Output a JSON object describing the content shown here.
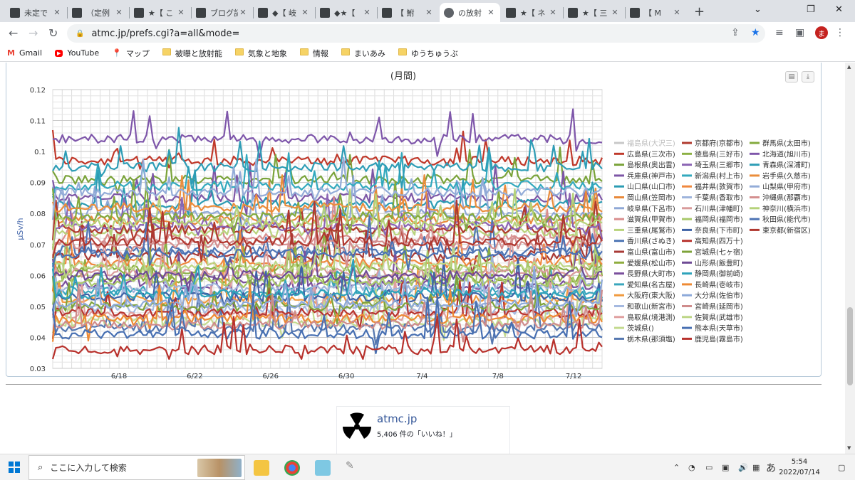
{
  "tabs": [
    {
      "title": "未定で",
      "close": "✕"
    },
    {
      "title": "（定例",
      "close": "✕"
    },
    {
      "title": "★【 こ",
      "close": "✕"
    },
    {
      "title": "ブログ記",
      "close": "✕"
    },
    {
      "title": "◆【 岐",
      "close": "✕"
    },
    {
      "title": "◆★【",
      "close": "✕"
    },
    {
      "title": "【 鮒",
      "close": "✕"
    },
    {
      "title": "の放射",
      "close": "✕",
      "active": true
    },
    {
      "title": "★【 ネ",
      "close": "✕"
    },
    {
      "title": "★【 三",
      "close": "✕"
    },
    {
      "title": "【 M",
      "close": "✕"
    }
  ],
  "newtab": "+",
  "window_controls": {
    "minimize": "⌄",
    "restore": "—",
    "maximize": "❐",
    "close": "✕"
  },
  "nav": {
    "back": "←",
    "forward": "→",
    "reload": "↻"
  },
  "url": "atmc.jp/prefs.cgi?a=all&mode=",
  "avatar_letter": "ま",
  "bookmarks": [
    {
      "label": "Gmail",
      "icon": "gmail-icon"
    },
    {
      "label": "YouTube",
      "icon": "youtube-icon"
    },
    {
      "label": "マップ",
      "icon": "maps-icon"
    },
    {
      "label": "被曝と放射能",
      "icon": "folder-icon"
    },
    {
      "label": "気象と地象",
      "icon": "folder-icon"
    },
    {
      "label": "情報",
      "icon": "folder-icon"
    },
    {
      "label": "まいあみ",
      "icon": "folder-icon"
    },
    {
      "label": "ゆうちゅうぶ",
      "icon": "folder-icon"
    }
  ],
  "chart_data": {
    "type": "line",
    "title": "(月間)",
    "ylabel": "μSv/h",
    "xlabel": "",
    "ylim": [
      0.03,
      0.12
    ],
    "yticks": [
      "0.03",
      "0.04",
      "0.05",
      "0.06",
      "0.07",
      "0.08",
      "0.09",
      "0.1",
      "0.11",
      "0.12"
    ],
    "xticks": [
      "6/18",
      "6/22",
      "6/26",
      "6/30",
      "7/4",
      "7/8",
      "7/12"
    ],
    "x_days": 29,
    "grid": true,
    "legend_position": "right",
    "series": [
      {
        "name": "福島県(大沢三)",
        "color": "#c8c8c8",
        "level": null
      },
      {
        "name": "広島県(三次市)",
        "color": "#c0392b",
        "level": 0.097
      },
      {
        "name": "島根県(奥出雲)",
        "color": "#7aa33a",
        "level": 0.091
      },
      {
        "name": "兵庫県(神戸市)",
        "color": "#7d56a6",
        "level": 0.085
      },
      {
        "name": "山口県(山口市)",
        "color": "#2b9cb3",
        "level": 0.083
      },
      {
        "name": "岡山県(笠岡市)",
        "color": "#e8893a",
        "level": 0.078
      },
      {
        "name": "岐阜県(下呂市)",
        "color": "#8fa8d6",
        "level": 0.08
      },
      {
        "name": "滋賀県(甲賀市)",
        "color": "#d98d8d",
        "level": 0.072
      },
      {
        "name": "三重県(尾鷲市)",
        "color": "#b9d37c",
        "level": 0.074
      },
      {
        "name": "香川県(さぬき)",
        "color": "#4e76b5",
        "level": 0.068
      },
      {
        "name": "富山県(富山市)",
        "color": "#a83a36",
        "level": 0.066
      },
      {
        "name": "愛媛県(松山市)",
        "color": "#8fad3f",
        "level": 0.059
      },
      {
        "name": "長野県(大町市)",
        "color": "#7a4f9d",
        "level": 0.057
      },
      {
        "name": "愛知県(名古屋)",
        "color": "#3aa6bd",
        "level": 0.055
      },
      {
        "name": "大阪府(東大阪)",
        "color": "#f09a3e",
        "level": 0.052
      },
      {
        "name": "和歌山(新宮市)",
        "color": "#a5b9e0",
        "level": 0.049
      },
      {
        "name": "鳥取県(境港測)",
        "color": "#e0a0a0",
        "level": 0.047
      },
      {
        "name": "茨城県()",
        "color": "#c3da8f",
        "level": 0.045
      },
      {
        "name": "栃木県(那須塩)",
        "color": "#5577b0",
        "level": 0.043
      },
      {
        "name": "京都府(京都市)",
        "color": "#b03a2e",
        "level": 0.075
      },
      {
        "name": "徳島県(三好市)",
        "color": "#8bb043",
        "level": 0.062
      },
      {
        "name": "埼玉県(三郷市)",
        "color": "#8b64b4",
        "level": 0.076
      },
      {
        "name": "新潟県(村上市)",
        "color": "#33a9be",
        "level": 0.089
      },
      {
        "name": "福井県(敦賀市)",
        "color": "#f0883e",
        "level": 0.064
      },
      {
        "name": "千葉県(香取市)",
        "color": "#9eb4dc",
        "level": 0.056
      },
      {
        "name": "石川県(津幡町)",
        "color": "#d99b9b",
        "level": 0.061
      },
      {
        "name": "福岡県(福岡市)",
        "color": "#a8c86a",
        "level": 0.058
      },
      {
        "name": "奈良県(下市町)",
        "color": "#3f63a6",
        "level": 0.053
      },
      {
        "name": "高知県(四万十)",
        "color": "#b8342f",
        "level": 0.048
      },
      {
        "name": "宮城県(七ヶ宿)",
        "color": "#7ea33a",
        "level": 0.05
      },
      {
        "name": "山形県(飯豊町)",
        "color": "#6e4a95",
        "level": 0.06
      },
      {
        "name": "静岡県(御前崎)",
        "color": "#2ea3bb",
        "level": 0.054
      },
      {
        "name": "長崎県(壱岐市)",
        "color": "#ee8a34",
        "level": 0.046
      },
      {
        "name": "大分県(佐伯市)",
        "color": "#8ca9d9",
        "level": 0.051
      },
      {
        "name": "宮崎県(延岡市)",
        "color": "#cf8c8c",
        "level": 0.044
      },
      {
        "name": "佐賀県(武雄市)",
        "color": "#bdd686",
        "level": 0.063
      },
      {
        "name": "熊本県(天草市)",
        "color": "#4870b2",
        "level": 0.041
      },
      {
        "name": "鹿児島(霧島市)",
        "color": "#b8312c",
        "level": 0.036
      },
      {
        "name": "群馬県(太田市)",
        "color": "#83aa3d",
        "level": 0.079
      },
      {
        "name": "北海道(旭川市)",
        "color": "#7e56aa",
        "level": 0.104
      },
      {
        "name": "青森県(深浦町)",
        "color": "#2e9db6",
        "level": 0.095
      },
      {
        "name": "岩手県(久慈市)",
        "color": "#eb8d3b",
        "level": 0.082
      },
      {
        "name": "山梨県(甲府市)",
        "color": "#93acd8",
        "level": 0.087
      },
      {
        "name": "沖縄県(那覇市)",
        "color": "#d48f8f",
        "level": 0.07
      },
      {
        "name": "神奈川(横浜市)",
        "color": "#b5d27a",
        "level": 0.077
      },
      {
        "name": "秋田県(能代市)",
        "color": "#4c72b4",
        "level": 0.067
      },
      {
        "name": "東京都(新宿区)",
        "color": "#b0372f",
        "level": 0.071
      }
    ]
  },
  "facebook": {
    "name": "atmc.jp",
    "likes": "5,406 件の「いいね！」"
  },
  "taskbar": {
    "search_placeholder": "ここに入力して検索",
    "time": "5:54",
    "date": "2022/07/14",
    "ime": "あ"
  }
}
